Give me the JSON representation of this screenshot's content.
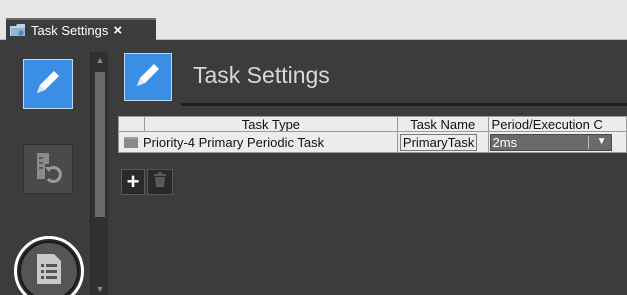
{
  "tab": {
    "label": "Task Settings",
    "close_glyph": "×",
    "icon": "folder-settings-icon"
  },
  "sidebar": {
    "buttons": [
      {
        "icon": "pencil-icon",
        "active": true
      },
      {
        "icon": "undo-document-icon",
        "active": false
      },
      {
        "icon": "list-document-icon",
        "highlighted": true
      }
    ]
  },
  "scrollbar": {
    "up_glyph": "▲",
    "down_glyph": "▼"
  },
  "main": {
    "title": "Task Settings",
    "title_icon": "pencil-icon"
  },
  "table": {
    "columns": [
      "",
      "Task Type",
      "Task Name",
      "Period/Execution C"
    ],
    "rows": [
      {
        "icon": "task-folder-icon",
        "task_type": "Priority-4 Primary Periodic Task",
        "task_name": "PrimaryTask",
        "period": "2ms"
      }
    ],
    "select_arrow": "▼"
  },
  "toolbar": {
    "add_glyph": "+",
    "add_icon": "plus-icon",
    "delete_icon": "trash-icon"
  },
  "colors": {
    "accent": "#3a8ee6",
    "panel_bg": "#3c3c3c",
    "table_bg": "#ececec"
  }
}
